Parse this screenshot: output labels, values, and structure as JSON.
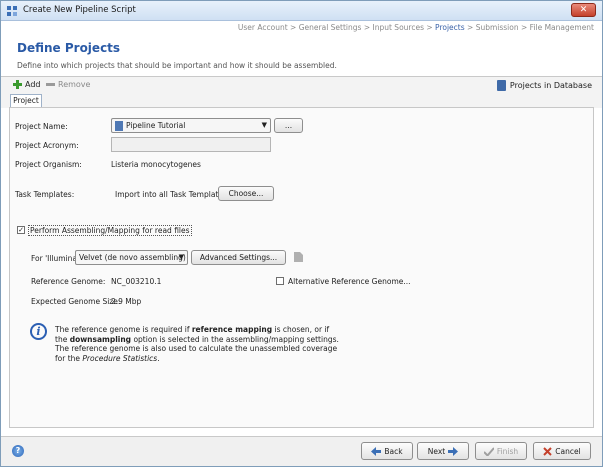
{
  "window": {
    "title": "Create New Pipeline Script",
    "close_label": "✕"
  },
  "breadcrumb": {
    "items": [
      "User Account",
      "General Settings",
      "Input Sources",
      "Projects",
      "Submission",
      "File Management"
    ],
    "separator": " > ",
    "active_index": 3
  },
  "header": {
    "title": "Define Projects",
    "description": "Define into which projects that should be important and how it should be assembled."
  },
  "toolbar": {
    "add_label": "Add",
    "remove_label": "Remove",
    "db_label": "Projects in Database"
  },
  "tabs": [
    {
      "label": "Project",
      "selected": true
    }
  ],
  "form": {
    "project_name_label": "Project Name:",
    "project_name_value": "Pipeline Tutorial",
    "project_name_browse": "...",
    "project_acronym_label": "Project Acronym:",
    "project_acronym_value": "",
    "project_organism_label": "Project Organism:",
    "project_organism_value": "Listeria monocytogenes",
    "task_templates_label": "Task Templates:",
    "task_templates_text": "Import into all Task Templates",
    "choose_button": "Choose...",
    "perform_assembling_label": "Perform Assembling/Mapping for read files",
    "perform_assembling_checked": true,
    "for_illumina_label": "For 'Illumina':",
    "assembler_value": "Velvet (de novo assembling)",
    "advanced_settings_button": "Advanced Settings...",
    "reference_genome_label": "Reference Genome:",
    "reference_genome_value": "NC_003210.1",
    "alt_reference_label": "Alternative Reference Genome...",
    "alt_reference_checked": false,
    "expected_size_label": "Expected Genome Size:",
    "expected_size_value": "2.9 Mbp"
  },
  "info": {
    "icon": "info-icon",
    "t1": "The reference genome is required if ",
    "b1": "reference mapping",
    "t2": " is chosen, or if",
    "t3": "the ",
    "b2": "downsampling",
    "t4": " option is selected in the assembling/mapping settings.",
    "t5": "The reference genome is also used to calculate the unassembled coverage",
    "t6": "for the ",
    "i1": "Procedure Statistics",
    "t7": "."
  },
  "footer": {
    "back": "Back",
    "next": "Next",
    "finish": "Finish",
    "cancel": "Cancel"
  },
  "colors": {
    "accent": "#2a5aa6",
    "title_bar": "#cfe0f3",
    "close_button": "#c4402b"
  }
}
